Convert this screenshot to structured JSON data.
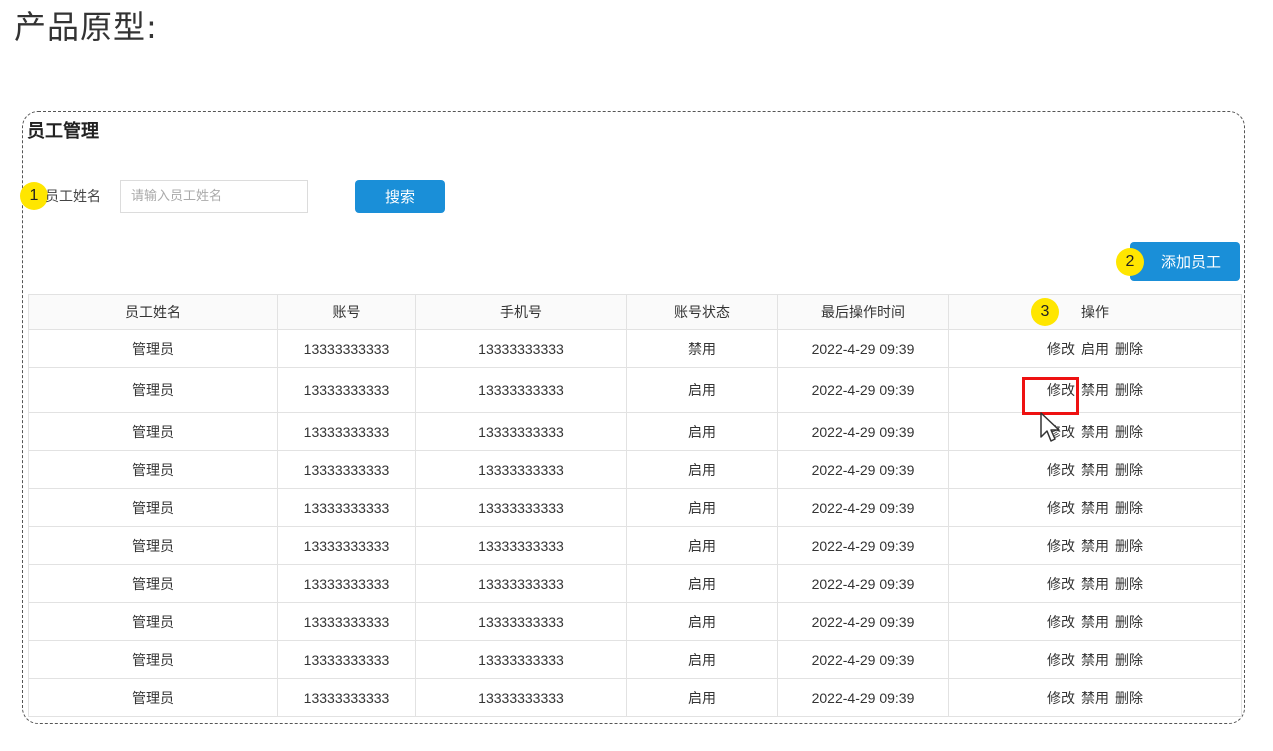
{
  "page": {
    "heading": "产品原型:"
  },
  "panel": {
    "title": "员工管理"
  },
  "search": {
    "label": "员工姓名",
    "placeholder": "请输入员工姓名",
    "button": "搜索"
  },
  "toolbar": {
    "add_button": "添加员工"
  },
  "badges": [
    "1",
    "2",
    "3"
  ],
  "colors": {
    "accent": "#1a8fd8",
    "badge": "#ffe600",
    "highlight": "#ee1111"
  },
  "table": {
    "columns": [
      "员工姓名",
      "账号",
      "手机号",
      "账号状态",
      "最后操作时间",
      "操作"
    ],
    "rows": [
      {
        "name": "管理员",
        "account": "13333333333",
        "phone": "13333333333",
        "status": "禁用",
        "time": "2022-4-29 09:39",
        "actions": [
          "修改",
          "启用",
          "删除"
        ]
      },
      {
        "name": "管理员",
        "account": "13333333333",
        "phone": "13333333333",
        "status": "启用",
        "time": "2022-4-29 09:39",
        "actions": [
          "修改",
          "禁用",
          "删除"
        ]
      },
      {
        "name": "管理员",
        "account": "13333333333",
        "phone": "13333333333",
        "status": "启用",
        "time": "2022-4-29 09:39",
        "actions": [
          "修改",
          "禁用",
          "删除"
        ]
      },
      {
        "name": "管理员",
        "account": "13333333333",
        "phone": "13333333333",
        "status": "启用",
        "time": "2022-4-29 09:39",
        "actions": [
          "修改",
          "禁用",
          "删除"
        ]
      },
      {
        "name": "管理员",
        "account": "13333333333",
        "phone": "13333333333",
        "status": "启用",
        "time": "2022-4-29 09:39",
        "actions": [
          "修改",
          "禁用",
          "删除"
        ]
      },
      {
        "name": "管理员",
        "account": "13333333333",
        "phone": "13333333333",
        "status": "启用",
        "time": "2022-4-29 09:39",
        "actions": [
          "修改",
          "禁用",
          "删除"
        ]
      },
      {
        "name": "管理员",
        "account": "13333333333",
        "phone": "13333333333",
        "status": "启用",
        "time": "2022-4-29 09:39",
        "actions": [
          "修改",
          "禁用",
          "删除"
        ]
      },
      {
        "name": "管理员",
        "account": "13333333333",
        "phone": "13333333333",
        "status": "启用",
        "time": "2022-4-29 09:39",
        "actions": [
          "修改",
          "禁用",
          "删除"
        ]
      },
      {
        "name": "管理员",
        "account": "13333333333",
        "phone": "13333333333",
        "status": "启用",
        "time": "2022-4-29 09:39",
        "actions": [
          "修改",
          "禁用",
          "删除"
        ]
      },
      {
        "name": "管理员",
        "account": "13333333333",
        "phone": "13333333333",
        "status": "启用",
        "time": "2022-4-29 09:39",
        "actions": [
          "修改",
          "禁用",
          "删除"
        ]
      }
    ]
  }
}
